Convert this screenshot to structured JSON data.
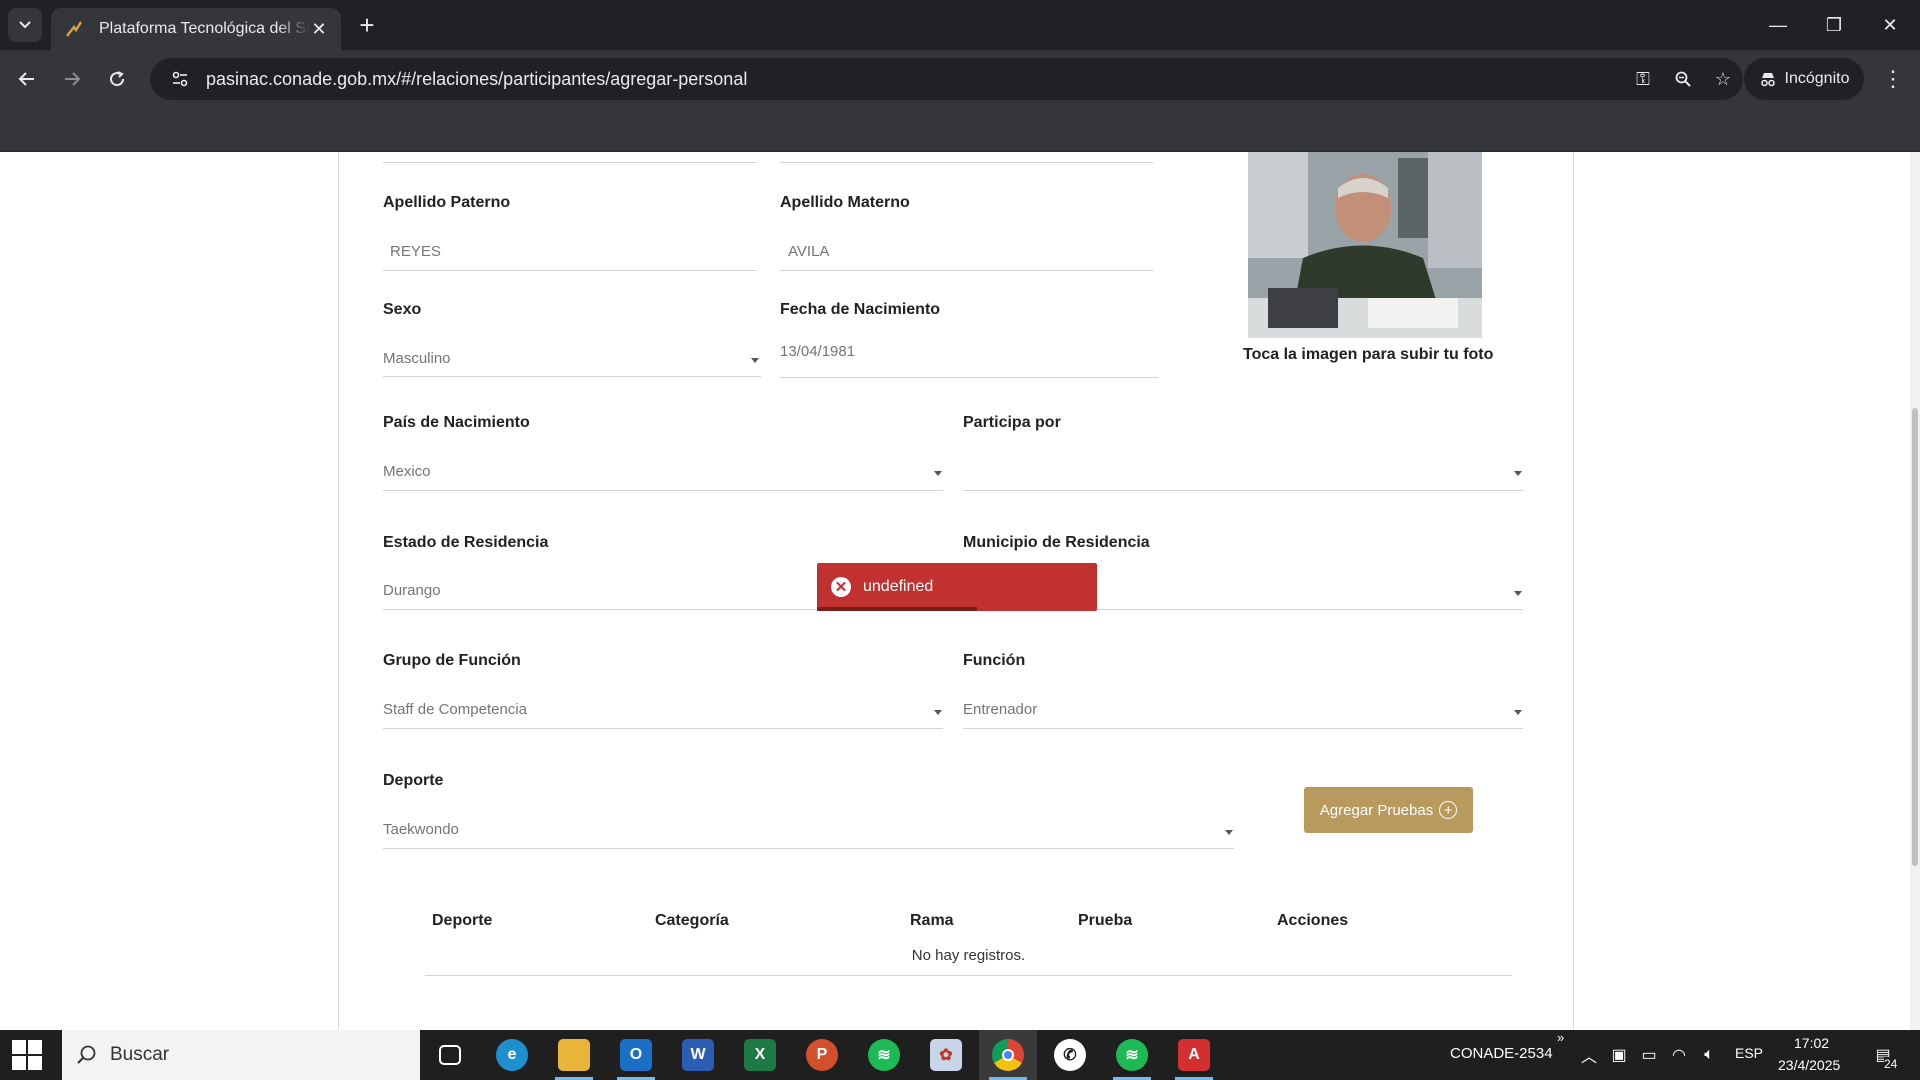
{
  "browser": {
    "tab_title": "Plataforma Tecnológica del Sistema",
    "url": "pasinac.conade.gob.mx/#/relaciones/participantes/agregar-personal",
    "incognito_label": "Incógnito"
  },
  "form": {
    "apellido_paterno": {
      "label": "Apellido Paterno",
      "value": "REYES"
    },
    "apellido_materno": {
      "label": "Apellido Materno",
      "value": "AVILA"
    },
    "sexo": {
      "label": "Sexo",
      "value": "Masculino"
    },
    "fecha_nacimiento": {
      "label": "Fecha de Nacimiento",
      "value": "13/04/1981"
    },
    "pais_nacimiento": {
      "label": "País de Nacimiento",
      "value": "Mexico"
    },
    "participa_por": {
      "label": "Participa por",
      "value": ""
    },
    "estado_residencia": {
      "label": "Estado de Residencia",
      "value": "Durango"
    },
    "municipio_residencia": {
      "label": "Municipio de Residencia",
      "value": ""
    },
    "grupo_funcion": {
      "label": "Grupo de Función",
      "value": "Staff de Competencia"
    },
    "funcion": {
      "label": "Función",
      "value": "Entrenador"
    },
    "deporte": {
      "label": "Deporte",
      "value": "Taekwondo"
    },
    "photo_caption": "Toca la imagen para subir tu foto",
    "agregar_pruebas_label": "Agregar Pruebas"
  },
  "table": {
    "headers": [
      "Deporte",
      "Categoría",
      "Rama",
      "Prueba",
      "Acciones"
    ],
    "empty_text": "No hay registros."
  },
  "toast": {
    "message": "undefined",
    "color": "#c0312f"
  },
  "taskbar": {
    "search_placeholder": "Buscar",
    "network_label": "CONADE-2534",
    "language": "ESP",
    "time": "17:02",
    "date": "23/4/2025",
    "notification_count": "24"
  }
}
